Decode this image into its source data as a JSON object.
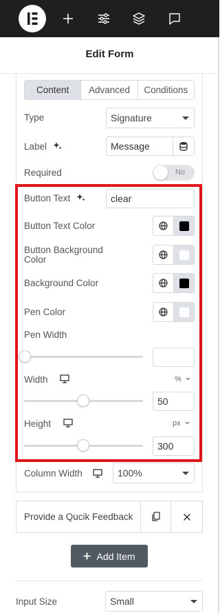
{
  "header": {
    "title": "Edit Form",
    "icons": [
      "elementor-logo",
      "plus-icon",
      "sliders-icon",
      "layers-icon",
      "chat-icon"
    ]
  },
  "tabs": [
    {
      "label": "Content",
      "active": true
    },
    {
      "label": "Advanced",
      "active": false
    },
    {
      "label": "Conditions",
      "active": false
    }
  ],
  "fields": {
    "type": {
      "label": "Type",
      "value": "Signature"
    },
    "label": {
      "label": "Label",
      "value": "Message"
    },
    "required": {
      "label": "Required",
      "toggle_text": "No"
    },
    "button_text": {
      "label": "Button Text",
      "value": "clear"
    },
    "button_text_color": {
      "label": "Button Text Color",
      "swatch": "#000000"
    },
    "button_bg_color": {
      "label_line1": "Button Background",
      "label_line2": "Color",
      "swatch": "#ffffff"
    },
    "background_color": {
      "label": "Background Color",
      "swatch": "#000000"
    },
    "pen_color": {
      "label": "Pen Color",
      "swatch": "#ffffff"
    },
    "pen_width": {
      "label": "Pen Width",
      "value": "",
      "slider": 0
    },
    "width": {
      "label": "Width",
      "unit": "%",
      "value": "50",
      "slider": 0.5
    },
    "height": {
      "label": "Height",
      "unit": "px",
      "value": "300",
      "slider": 0.5
    },
    "column_width": {
      "label": "Column Width",
      "value": "100%"
    }
  },
  "feedback": {
    "text": "Provide a Qucik Feedback"
  },
  "add_item": {
    "label": "Add Item"
  },
  "input_size": {
    "label": "Input Size",
    "value": "Small"
  },
  "colors": {
    "highlight": "#e0151a",
    "topbar": "#1f1f1f",
    "button": "#515962"
  }
}
